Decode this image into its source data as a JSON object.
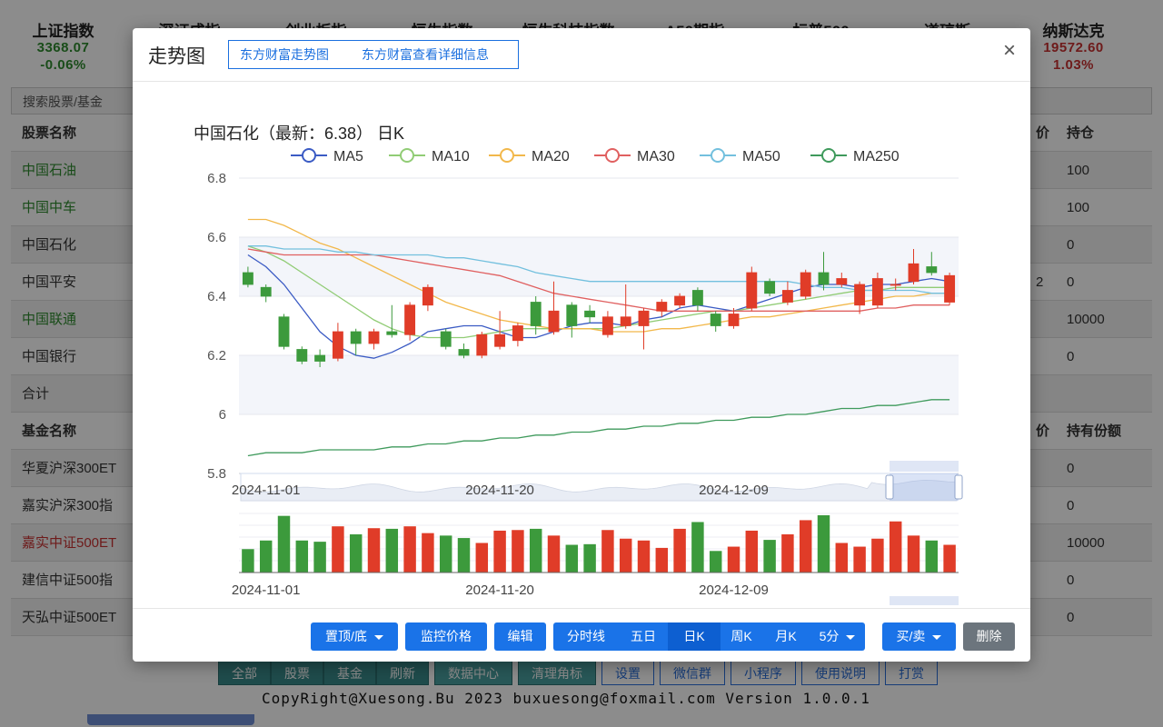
{
  "indices": [
    {
      "name": "上证指数",
      "value": "3368.07",
      "pct": "-0.06%",
      "color": "green"
    },
    {
      "name": "深证成指",
      "value": "",
      "pct": "",
      "color": "green"
    },
    {
      "name": "创业板指",
      "value": "",
      "pct": "",
      "color": "green"
    },
    {
      "name": "恒生指数",
      "value": "",
      "pct": "",
      "color": "green"
    },
    {
      "name": "恒生科技指数",
      "value": "",
      "pct": "",
      "color": "green"
    },
    {
      "name": "A50期指",
      "value": "",
      "pct": "",
      "color": "green"
    },
    {
      "name": "标普500",
      "value": "",
      "pct": "",
      "color": "green"
    },
    {
      "name": "道琼斯",
      "value": "",
      "pct": "",
      "color": "green"
    },
    {
      "name": "纳斯达克",
      "value": "19572.60",
      "pct": "1.03%",
      "color": "red"
    }
  ],
  "search": {
    "placeholder": "搜索股票/基金"
  },
  "stock_table": {
    "headers": [
      "股票名称",
      "价",
      "持仓"
    ],
    "rows": [
      {
        "name": "中国石油",
        "color": "green",
        "c2": "",
        "c3": "100"
      },
      {
        "name": "中国中车",
        "color": "green",
        "c2": "",
        "c3": "100"
      },
      {
        "name": "中国石化",
        "color": "dark",
        "c2": "",
        "c3": "0"
      },
      {
        "name": "中国平安",
        "color": "dark",
        "c2": "2",
        "c3": "0"
      },
      {
        "name": "中国联通",
        "color": "green",
        "c2": "",
        "c3": "10000"
      },
      {
        "name": "中国银行",
        "color": "dark",
        "c2": "",
        "c3": "0"
      },
      {
        "name": "合计",
        "color": "dark",
        "c2": "",
        "c3": ""
      }
    ]
  },
  "fund_table": {
    "headers": [
      "基金名称",
      "价",
      "持有份额"
    ],
    "rows": [
      {
        "name": "华夏沪深300ET",
        "color": "dark",
        "c3": "0"
      },
      {
        "name": "嘉实沪深300指",
        "color": "dark",
        "c3": "0"
      },
      {
        "name": "嘉实中证500ET",
        "color": "red",
        "c3": "10000"
      },
      {
        "name": "建信中证500指",
        "color": "dark",
        "c3": "0"
      },
      {
        "name": "天弘中证500ET",
        "color": "dark",
        "c3": "0"
      }
    ]
  },
  "bottom_buttons": [
    "全部",
    "股票",
    "基金",
    "刷新",
    "数据中心",
    "清理角标",
    "设置",
    "微信群",
    "小程序",
    "使用说明",
    "打赏"
  ],
  "copyright": "CopyRight@Xuesong.Bu 2023 buxuesong@foxmail.com Version 1.0.0.1",
  "modal": {
    "title": "走势图",
    "btn_trend": "东方财富走势图",
    "btn_detail": "东方财富查看详细信息",
    "close": "×"
  },
  "footer": {
    "pin": "置顶/底",
    "monitor": "监控价格",
    "edit": "编辑",
    "periods": [
      "分时线",
      "五日",
      "日K",
      "周K",
      "月K",
      "5分"
    ],
    "active_period": "日K",
    "trade": "买/卖",
    "delete": "删除"
  },
  "colors": {
    "up": "#e03c28",
    "down": "#3c9a3c",
    "accent": "#1a73e8"
  },
  "chart_data": {
    "type": "candlestick",
    "title": "中国石化（最新：6.38） 日K",
    "legend": [
      {
        "name": "MA5",
        "color": "#3b5bc4"
      },
      {
        "name": "MA10",
        "color": "#91cc75"
      },
      {
        "name": "MA20",
        "color": "#f2b84b"
      },
      {
        "name": "MA30",
        "color": "#e06060"
      },
      {
        "name": "MA50",
        "color": "#73c0de"
      },
      {
        "name": "MA250",
        "color": "#3f9a5c"
      }
    ],
    "ylim": [
      5.8,
      6.8
    ],
    "yticks": [
      "6.8",
      "6.6",
      "6.4",
      "6.2",
      "6",
      "5.8"
    ],
    "x_labels": [
      "2024-11-01",
      "2024-11-20",
      "2024-12-09"
    ],
    "x_label_index": [
      1,
      14,
      27
    ],
    "candles": [
      [
        6.48,
        6.44,
        6.5,
        6.43
      ],
      [
        6.43,
        6.4,
        6.44,
        6.38
      ],
      [
        6.33,
        6.23,
        6.34,
        6.22
      ],
      [
        6.22,
        6.18,
        6.23,
        6.17
      ],
      [
        6.2,
        6.18,
        6.22,
        6.16
      ],
      [
        6.19,
        6.28,
        6.31,
        6.18
      ],
      [
        6.28,
        6.24,
        6.29,
        6.2
      ],
      [
        6.24,
        6.28,
        6.29,
        6.22
      ],
      [
        6.28,
        6.27,
        6.37,
        6.26
      ],
      [
        6.27,
        6.37,
        6.38,
        6.25
      ],
      [
        6.37,
        6.43,
        6.44,
        6.35
      ],
      [
        6.28,
        6.23,
        6.29,
        6.22
      ],
      [
        6.22,
        6.2,
        6.24,
        6.19
      ],
      [
        6.2,
        6.27,
        6.28,
        6.19
      ],
      [
        6.23,
        6.27,
        6.35,
        6.22
      ],
      [
        6.25,
        6.3,
        6.31,
        6.23
      ],
      [
        6.38,
        6.3,
        6.4,
        6.27
      ],
      [
        6.28,
        6.35,
        6.45,
        6.27
      ],
      [
        6.37,
        6.3,
        6.38,
        6.26
      ],
      [
        6.35,
        6.33,
        6.37,
        6.31
      ],
      [
        6.27,
        6.33,
        6.35,
        6.26
      ],
      [
        6.3,
        6.33,
        6.44,
        6.29
      ],
      [
        6.3,
        6.35,
        6.36,
        6.22
      ],
      [
        6.35,
        6.38,
        6.39,
        6.33
      ],
      [
        6.37,
        6.4,
        6.41,
        6.36
      ],
      [
        6.42,
        6.37,
        6.43,
        6.35
      ],
      [
        6.34,
        6.3,
        6.35,
        6.28
      ],
      [
        6.3,
        6.34,
        6.36,
        6.29
      ],
      [
        6.36,
        6.48,
        6.5,
        6.35
      ],
      [
        6.45,
        6.41,
        6.46,
        6.4
      ],
      [
        6.38,
        6.42,
        6.45,
        6.37
      ],
      [
        6.4,
        6.48,
        6.49,
        6.39
      ],
      [
        6.48,
        6.44,
        6.55,
        6.42
      ],
      [
        6.44,
        6.46,
        6.48,
        6.43
      ],
      [
        6.37,
        6.44,
        6.45,
        6.34
      ],
      [
        6.37,
        6.46,
        6.48,
        6.36
      ],
      [
        6.44,
        6.44,
        6.46,
        6.42
      ],
      [
        6.45,
        6.51,
        6.56,
        6.44
      ],
      [
        6.5,
        6.48,
        6.55,
        6.47
      ],
      [
        6.38,
        6.47,
        6.48,
        6.37
      ]
    ],
    "ma": {
      "MA5": [
        6.54,
        6.5,
        6.44,
        6.36,
        6.28,
        6.23,
        6.2,
        6.19,
        6.21,
        6.24,
        6.28,
        6.29,
        6.3,
        6.3,
        6.28,
        6.26,
        6.26,
        6.28,
        6.3,
        6.31,
        6.31,
        6.3,
        6.32,
        6.33,
        6.36,
        6.37,
        6.36,
        6.35,
        6.37,
        6.39,
        6.41,
        6.43,
        6.44,
        6.44,
        6.43,
        6.44,
        6.44,
        6.45,
        6.46,
        6.45
      ],
      "MA10": [
        6.57,
        6.55,
        6.52,
        6.48,
        6.44,
        6.4,
        6.36,
        6.32,
        6.29,
        6.27,
        6.26,
        6.26,
        6.26,
        6.27,
        6.28,
        6.29,
        6.29,
        6.29,
        6.29,
        6.29,
        6.29,
        6.3,
        6.31,
        6.32,
        6.33,
        6.34,
        6.35,
        6.35,
        6.36,
        6.37,
        6.38,
        6.39,
        6.4,
        6.41,
        6.42,
        6.42,
        6.43,
        6.43,
        6.43,
        6.43
      ],
      "MA20": [
        6.66,
        6.66,
        6.64,
        6.61,
        6.58,
        6.56,
        6.53,
        6.5,
        6.47,
        6.44,
        6.41,
        6.38,
        6.36,
        6.34,
        6.32,
        6.31,
        6.3,
        6.29,
        6.29,
        6.29,
        6.28,
        6.28,
        6.28,
        6.29,
        6.29,
        6.3,
        6.31,
        6.32,
        6.33,
        6.33,
        6.34,
        6.35,
        6.36,
        6.37,
        6.38,
        6.39,
        6.4,
        6.4,
        6.41,
        6.41
      ],
      "MA30": [
        6.56,
        6.55,
        6.54,
        6.54,
        6.54,
        6.54,
        6.54,
        6.54,
        6.53,
        6.52,
        6.51,
        6.5,
        6.49,
        6.48,
        6.47,
        6.45,
        6.43,
        6.41,
        6.4,
        6.39,
        6.38,
        6.37,
        6.36,
        6.35,
        6.35,
        6.35,
        6.35,
        6.35,
        6.35,
        6.35,
        6.35,
        6.35,
        6.35,
        6.35,
        6.35,
        6.36,
        6.36,
        6.37,
        6.37,
        6.37
      ],
      "MA50": [
        6.57,
        6.57,
        6.56,
        6.56,
        6.56,
        6.55,
        6.55,
        6.54,
        6.54,
        6.54,
        6.54,
        6.53,
        6.53,
        6.52,
        6.51,
        6.5,
        6.48,
        6.47,
        6.46,
        6.45,
        6.45,
        6.45,
        6.45,
        6.45,
        6.45,
        6.45,
        6.45,
        6.45,
        6.45,
        6.45,
        6.45,
        6.44,
        6.43,
        6.43,
        6.42,
        6.42,
        6.42,
        6.42,
        6.41,
        6.41
      ],
      "MA250": [
        5.86,
        5.87,
        5.87,
        5.87,
        5.88,
        5.88,
        5.88,
        5.88,
        5.89,
        5.89,
        5.9,
        5.9,
        5.91,
        5.91,
        5.92,
        5.92,
        5.93,
        5.93,
        5.94,
        5.94,
        5.95,
        5.95,
        5.96,
        5.96,
        5.97,
        5.97,
        5.98,
        5.98,
        5.99,
        5.99,
        6.0,
        6.0,
        6.01,
        6.02,
        6.02,
        6.03,
        6.03,
        6.04,
        6.05,
        6.05
      ]
    },
    "volume": [
      38,
      52,
      92,
      52,
      50,
      75,
      62,
      72,
      71,
      75,
      64,
      60,
      56,
      48,
      68,
      69,
      71,
      60,
      45,
      46,
      69,
      55,
      52,
      40,
      71,
      82,
      35,
      42,
      68,
      53,
      62,
      85,
      93,
      48,
      42,
      55,
      83,
      60,
      52,
      45
    ]
  }
}
